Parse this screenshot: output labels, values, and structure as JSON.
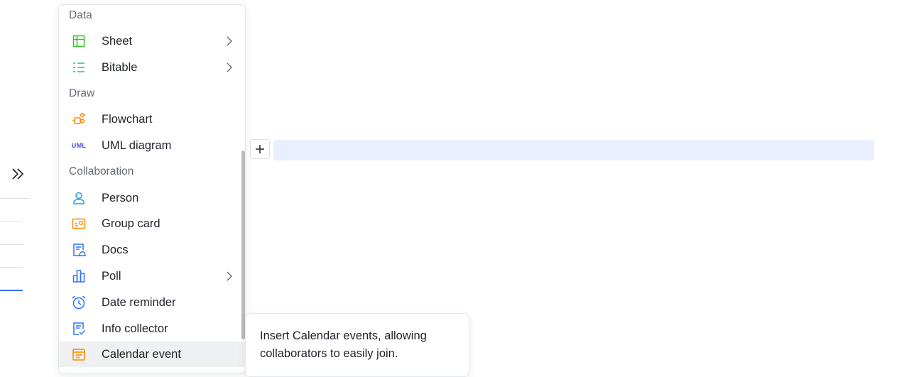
{
  "sidebar": {
    "expand_icon": "double-chevron-right-icon"
  },
  "menu": {
    "sections": [
      {
        "title": "Data",
        "items": [
          {
            "label": "Sheet",
            "icon": "sheet-icon",
            "submenu": true,
            "color": "#34c724"
          },
          {
            "label": "Bitable",
            "icon": "bitable-icon",
            "submenu": true,
            "color": "#14c0a8"
          }
        ]
      },
      {
        "title": "Draw",
        "items": [
          {
            "label": "Flowchart",
            "icon": "flowchart-icon",
            "submenu": false,
            "color": "#ff8800"
          },
          {
            "label": "UML diagram",
            "icon": "uml-icon",
            "icon_text": "UML",
            "submenu": false,
            "color": "#4e4bd8"
          }
        ]
      },
      {
        "title": "Collaboration",
        "items": [
          {
            "label": "Person",
            "icon": "person-icon",
            "submenu": false,
            "color": "#1ea1f2"
          },
          {
            "label": "Group card",
            "icon": "group-card-icon",
            "submenu": false,
            "color": "#ff8800"
          },
          {
            "label": "Docs",
            "icon": "docs-icon",
            "submenu": false,
            "color": "#3370ff"
          },
          {
            "label": "Poll",
            "icon": "poll-icon",
            "submenu": true,
            "color": "#3370ff"
          },
          {
            "label": "Date reminder",
            "icon": "alarm-clock-icon",
            "submenu": false,
            "color": "#3370ff"
          },
          {
            "label": "Info collector",
            "icon": "info-collector-icon",
            "submenu": false,
            "color": "#3370ff"
          },
          {
            "label": "Calendar event",
            "icon": "calendar-icon",
            "submenu": false,
            "color": "#ff8800",
            "hovered": true
          }
        ]
      }
    ]
  },
  "editor": {
    "add_block_icon": "plus-icon",
    "accent": "#3370ff",
    "highlight_color": "#e9efff"
  },
  "tooltip": {
    "text": "Insert Calendar events, allowing collaborators to easily join."
  }
}
